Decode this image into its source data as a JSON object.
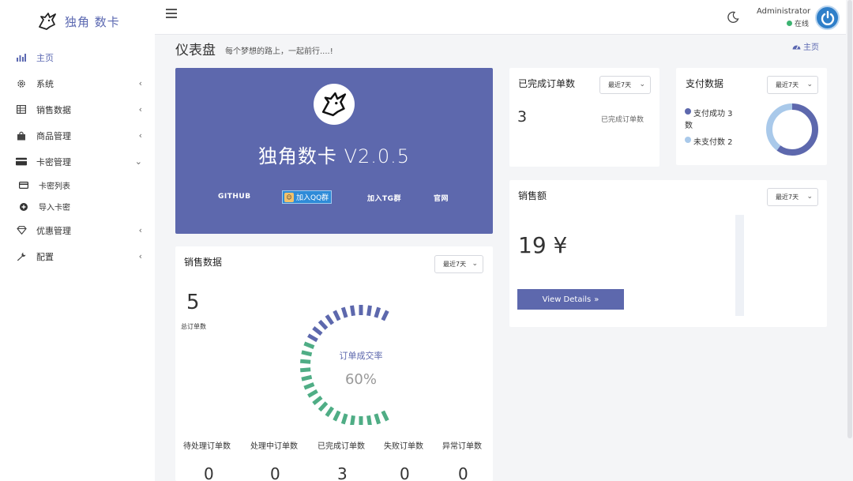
{
  "brand": {
    "name": "独角 数卡",
    "logo_icon": "unicorn-icon"
  },
  "sidebar": {
    "items": [
      {
        "label": "主页",
        "icon": "bar-chart-icon",
        "active": true
      },
      {
        "label": "系统",
        "icon": "gear-icon",
        "chevron": "‹"
      },
      {
        "label": "销售数据",
        "icon": "table-icon",
        "chevron": "‹"
      },
      {
        "label": "商品管理",
        "icon": "shopping-bag-icon",
        "chevron": "‹"
      },
      {
        "label": "卡密管理",
        "icon": "credit-card-icon",
        "chevron": "⌄"
      },
      {
        "label": "卡密列表",
        "icon": "card-small-icon",
        "sub": true
      },
      {
        "label": "导入卡密",
        "icon": "plus-circle-icon",
        "sub": true
      },
      {
        "label": "优惠管理",
        "icon": "diamond-icon",
        "chevron": "‹"
      },
      {
        "label": "配置",
        "icon": "wrench-icon",
        "chevron": "‹"
      }
    ]
  },
  "topbar": {
    "user_name": "Administrator",
    "user_status": "在线",
    "status_color": "#3cb371"
  },
  "page": {
    "title": "仪表盘",
    "subtitle": "每个梦想的路上，一起前行....!",
    "breadcrumb": "主页"
  },
  "hero": {
    "title": "独角数卡 V2.0.5",
    "links": {
      "github": "GITHUB",
      "qq": "加入QQ群",
      "tg": "加入TG群",
      "site": "官网"
    },
    "bg_color": "#5d68ad"
  },
  "sales": {
    "title": "销售数据",
    "range": "最近7天",
    "total_value": "5",
    "total_label": "总订单数",
    "gauge_label": "订单成交率",
    "gauge_value": "60%",
    "gauge_fraction": 0.6,
    "stats": [
      {
        "label": "待处理订单数",
        "value": "0"
      },
      {
        "label": "处理中订单数",
        "value": "0"
      },
      {
        "label": "已完成订单数",
        "value": "3"
      },
      {
        "label": "失败订单数",
        "value": "0"
      },
      {
        "label": "异常订单数",
        "value": "0"
      }
    ]
  },
  "orders": {
    "title": "已完成订单数",
    "range": "最近7天",
    "value": "3",
    "label": "已完成订单数"
  },
  "payment": {
    "title": "支付数据",
    "range": "最近7天",
    "legend": [
      {
        "label": "支付成功 3",
        "suffix": "数",
        "color": "#5d68ad",
        "value": 3
      },
      {
        "label": "未支付数 2",
        "color": "#a9c9ea",
        "value": 2
      }
    ]
  },
  "revenue": {
    "title": "销售额",
    "range": "最近7天",
    "value": "19 ¥",
    "button": "View Details",
    "button_icon": "»"
  },
  "colors": {
    "accent": "#5d68ad",
    "gauge_green": "#4fad85",
    "gauge_blue": "#5d68ad"
  }
}
